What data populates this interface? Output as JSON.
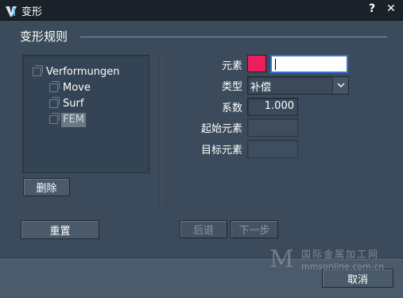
{
  "window": {
    "title": "变形",
    "help_label": "?",
    "close_label": "✕"
  },
  "section": {
    "title": "变形规则"
  },
  "tree": {
    "root": "Verformungen",
    "children": [
      "Move",
      "Surf",
      "FEM"
    ],
    "selected": "FEM"
  },
  "buttons": {
    "delete": "删除",
    "reset": "重置",
    "back": "后退",
    "next": "下一步",
    "cancel": "取消"
  },
  "form": {
    "element_label": "元素",
    "element_color": "#ee1d5e",
    "element_value": "",
    "type_label": "类型",
    "type_value": "补偿",
    "coef_label": "系数",
    "coef_value": "1.000",
    "start_label": "起始元素",
    "start_value": "",
    "target_label": "目标元素",
    "target_value": ""
  },
  "watermark": {
    "letter": "M",
    "text_cn": "国际金属加工网",
    "url": "mmsonline.com.cn"
  }
}
